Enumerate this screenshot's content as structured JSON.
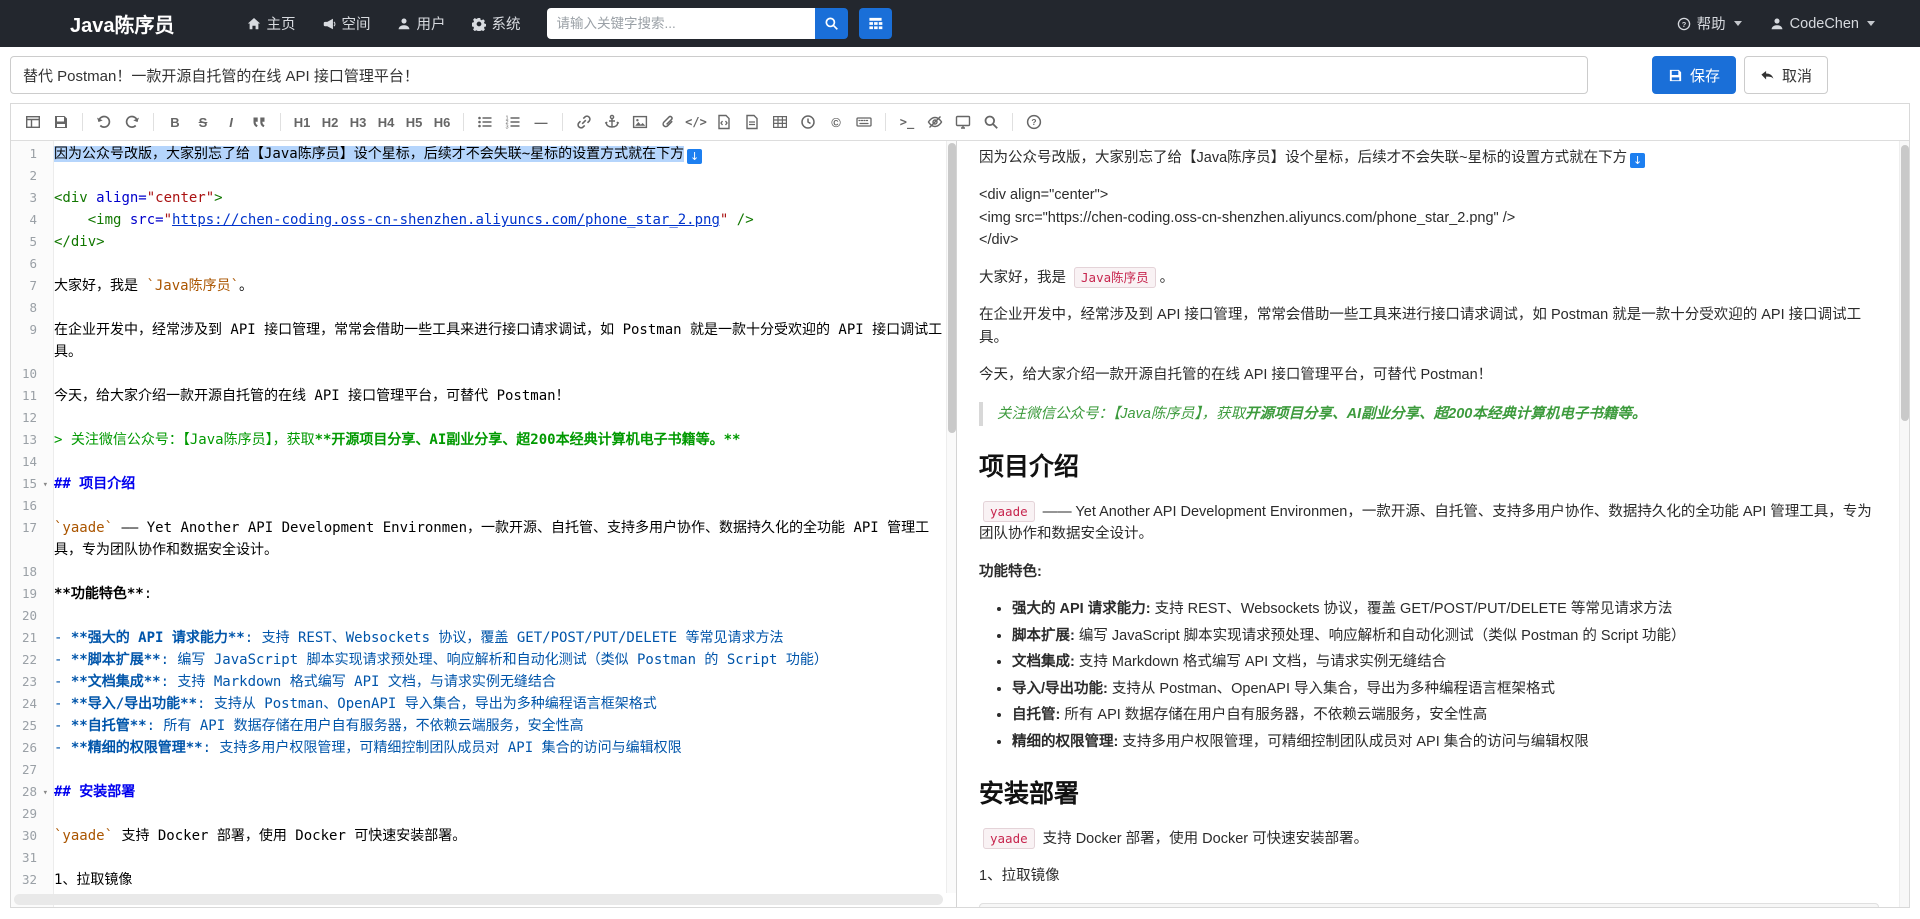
{
  "colors": {
    "navbar_bg": "#23272e",
    "accent_blue": "#1a6fd8",
    "selection_blue": "#b5d5fc",
    "inline_code_red": "#c7254e",
    "quote_green": "#3d9b3d"
  },
  "navbar": {
    "brand": "Java陈序员",
    "items": [
      {
        "icon": "home",
        "label": "主页"
      },
      {
        "icon": "bullhorn",
        "label": "空间"
      },
      {
        "icon": "user",
        "label": "用户"
      },
      {
        "icon": "gear",
        "label": "系统"
      }
    ],
    "search": {
      "placeholder": "请输入关键字搜索...",
      "button_icon": "search",
      "grid_button_icon": "grid"
    },
    "help_label": "帮助",
    "help_icon": "question-circle",
    "user_label": "CodeChen",
    "user_icon": "user"
  },
  "title_bar": {
    "title_value": "替代 Postman！一款开源自托管的在线 API 接口管理平台！",
    "save_label": "保存",
    "save_icon": "floppy",
    "cancel_label": "取消",
    "cancel_icon": "reply"
  },
  "toolbar": {
    "groups": [
      [
        "window",
        "save"
      ],
      [
        "undo",
        "redo"
      ],
      [
        "bold",
        "strikethrough",
        "italic",
        "quote"
      ],
      [
        "h1",
        "h2",
        "h3",
        "h4",
        "h5",
        "h6"
      ],
      [
        "list-ul",
        "list-ol",
        "horizontal-rule"
      ],
      [
        "link",
        "anchor",
        "image",
        "attachment",
        "inline-code",
        "code-block",
        "html-block",
        "table",
        "datetime",
        "copyright",
        "keyboard"
      ],
      [
        "terminal",
        "eye-slash",
        "monitor",
        "search"
      ],
      [
        "help"
      ]
    ]
  },
  "editor": {
    "lines": [
      {
        "n": 1,
        "active": true,
        "segments": [
          {
            "t": "因为公众号改版，大家别忘了给【Java陈序员】设个星标，后续才不会失联~星标的设置方式就在下方",
            "c": "txt",
            "sel": true
          },
          {
            "t": "👇",
            "c": "emoji",
            "sel": true
          }
        ]
      },
      {
        "n": 2
      },
      {
        "n": 3,
        "segments": [
          {
            "t": "<div ",
            "c": "tag"
          },
          {
            "t": "align=",
            "c": "attr"
          },
          {
            "t": "\"center\"",
            "c": "str"
          },
          {
            "t": ">",
            "c": "tag"
          }
        ]
      },
      {
        "n": 4,
        "segments": [
          {
            "t": "    ",
            "c": "txt"
          },
          {
            "t": "<img ",
            "c": "tag"
          },
          {
            "t": "src=",
            "c": "attr"
          },
          {
            "t": "\"",
            "c": "str"
          },
          {
            "t": "https://chen-coding.oss-cn-shenzhen.aliyuncs.com/phone_star_2.png",
            "c": "link"
          },
          {
            "t": "\"",
            "c": "str"
          },
          {
            "t": " />",
            "c": "tag"
          }
        ]
      },
      {
        "n": 5,
        "segments": [
          {
            "t": "</div>",
            "c": "tag"
          }
        ]
      },
      {
        "n": 6
      },
      {
        "n": 7,
        "segments": [
          {
            "t": "大家好，我是 ",
            "c": "txt"
          },
          {
            "t": "`Java陈序员`",
            "c": "code"
          },
          {
            "t": "。",
            "c": "txt"
          }
        ]
      },
      {
        "n": 8
      },
      {
        "n": 9,
        "segments": [
          {
            "t": "在企业开发中，经常涉及到 API 接口管理，常常会借助一些工具来进行接口请求调试，如 Postman 就是一款十分受欢迎的 API 接口调试工具。",
            "c": "txt"
          }
        ]
      },
      {
        "n": 10
      },
      {
        "n": 11,
        "segments": [
          {
            "t": "今天，给大家介绍一款开源自托管的在线 API 接口管理平台，可替代 Postman！",
            "c": "txt"
          }
        ]
      },
      {
        "n": 12
      },
      {
        "n": 13,
        "segments": [
          {
            "t": "> 关注微信公众号：【Java陈序员】，获取",
            "c": "quote"
          },
          {
            "t": "**开源项目分享、AI副业分享、超200本经典计算机电子书籍等。**",
            "c": "quote-strong"
          }
        ]
      },
      {
        "n": 14
      },
      {
        "n": 15,
        "fold": true,
        "segments": [
          {
            "t": "## 项目介绍",
            "c": "header"
          }
        ]
      },
      {
        "n": 16
      },
      {
        "n": 17,
        "segments": [
          {
            "t": "`yaade`",
            "c": "code"
          },
          {
            "t": " —— Yet Another API Development Environmen，一款开源、自托管、支持多用户协作、数据持久化的全功能 API 管理工具，专为团队协作和数据安全设计。",
            "c": "txt"
          }
        ]
      },
      {
        "n": 18
      },
      {
        "n": 19,
        "segments": [
          {
            "t": "**功能特色**",
            "c": "strong"
          },
          {
            "t": ":",
            "c": "txt"
          }
        ]
      },
      {
        "n": 20
      },
      {
        "n": 21,
        "segments": [
          {
            "t": "- ",
            "c": "list"
          },
          {
            "t": "**强大的 API 请求能力**",
            "c": "list-strong"
          },
          {
            "t": ": 支持 REST、Websockets 协议，覆盖 GET/POST/PUT/DELETE 等常见请求方法",
            "c": "list"
          }
        ]
      },
      {
        "n": 22,
        "segments": [
          {
            "t": "- ",
            "c": "list"
          },
          {
            "t": "**脚本扩展**",
            "c": "list-strong"
          },
          {
            "t": ": 编写 JavaScript 脚本实现请求预处理、响应解析和自动化测试（类似 Postman 的 Script 功能）",
            "c": "list"
          }
        ]
      },
      {
        "n": 23,
        "segments": [
          {
            "t": "- ",
            "c": "list"
          },
          {
            "t": "**文档集成**",
            "c": "list-strong"
          },
          {
            "t": ": 支持 Markdown 格式编写 API 文档，与请求实例无缝结合",
            "c": "list"
          }
        ]
      },
      {
        "n": 24,
        "segments": [
          {
            "t": "- ",
            "c": "list"
          },
          {
            "t": "**导入/导出功能**",
            "c": "list-strong"
          },
          {
            "t": ": 支持从 Postman、OpenAPI 导入集合，导出为多种编程语言框架格式",
            "c": "list"
          }
        ]
      },
      {
        "n": 25,
        "segments": [
          {
            "t": "- ",
            "c": "list"
          },
          {
            "t": "**自托管**",
            "c": "list-strong"
          },
          {
            "t": ": 所有 API 数据存储在用户自有服务器，不依赖云端服务，安全性高",
            "c": "list"
          }
        ]
      },
      {
        "n": 26,
        "segments": [
          {
            "t": "- ",
            "c": "list"
          },
          {
            "t": "**精细的权限管理**",
            "c": "list-strong"
          },
          {
            "t": ": 支持多用户权限管理，可精细控制团队成员对 API 集合的访问与编辑权限",
            "c": "list"
          }
        ]
      },
      {
        "n": 27
      },
      {
        "n": 28,
        "fold": true,
        "segments": [
          {
            "t": "## 安装部署",
            "c": "header"
          }
        ]
      },
      {
        "n": 29
      },
      {
        "n": 30,
        "segments": [
          {
            "t": "`yaade`",
            "c": "code"
          },
          {
            "t": " 支持 Docker 部署，使用 Docker 可快速安装部署。",
            "c": "txt"
          }
        ]
      },
      {
        "n": 31
      },
      {
        "n": 32,
        "segments": [
          {
            "t": "1、拉取镜像",
            "c": "txt"
          }
        ]
      }
    ]
  },
  "preview": {
    "blocks": [
      {
        "type": "p",
        "runs": [
          {
            "t": "因为公众号改版，大家别忘了给【Java陈序员】设个星标，后续才不会失联~星标的设置方式就在下方"
          },
          {
            "t": "👇",
            "emoji": true
          }
        ]
      },
      {
        "type": "p",
        "mt": true,
        "runs": [
          {
            "t": "<div align=\"center\">"
          },
          {
            "br": true
          },
          {
            "t": "<img src=\"https://chen-coding.oss-cn-shenzhen.aliyuncs.com/phone_star_2.png\" />"
          },
          {
            "br": true
          },
          {
            "t": "</div>"
          }
        ]
      },
      {
        "type": "p",
        "mt": true,
        "runs": [
          {
            "t": "大家好，我是 "
          },
          {
            "t": "Java陈序员",
            "code": true
          },
          {
            "t": "。"
          }
        ]
      },
      {
        "type": "p",
        "runs": [
          {
            "t": "在企业开发中，经常涉及到 API 接口管理，常常会借助一些工具来进行接口请求调试，如 Postman 就是一款十分受欢迎的 API 接口调试工具。"
          }
        ]
      },
      {
        "type": "p",
        "runs": [
          {
            "t": "今天，给大家介绍一款开源自托管的在线 API 接口管理平台，可替代 Postman！"
          }
        ]
      },
      {
        "type": "blockquote",
        "runs": [
          {
            "t": "关注微信公众号：【Java陈序员】，获取",
            "i": true
          },
          {
            "t": "开源项目分享、AI副业分享、超200本经典计算机电子书籍等。",
            "i": true,
            "b": true
          }
        ]
      },
      {
        "type": "h2",
        "text": "项目介绍"
      },
      {
        "type": "p",
        "runs": [
          {
            "t": "yaade",
            "code": true
          },
          {
            "t": " —— Yet Another API Development Environmen，一款开源、自托管、支持多用户协作、数据持久化的全功能 API 管理工具，专为团队协作和数据安全设计。"
          }
        ]
      },
      {
        "type": "p",
        "runs": [
          {
            "t": "功能特色:",
            "b": true
          }
        ]
      },
      {
        "type": "ul",
        "items": [
          [
            {
              "t": "强大的 API 请求能力:",
              "b": true
            },
            {
              "t": " 支持 REST、Websockets 协议，覆盖 GET/POST/PUT/DELETE 等常见请求方法"
            }
          ],
          [
            {
              "t": "脚本扩展:",
              "b": true
            },
            {
              "t": " 编写 JavaScript 脚本实现请求预处理、响应解析和自动化测试（类似 Postman 的 Script 功能）"
            }
          ],
          [
            {
              "t": "文档集成:",
              "b": true
            },
            {
              "t": " 支持 Markdown 格式编写 API 文档，与请求实例无缝结合"
            }
          ],
          [
            {
              "t": "导入/导出功能:",
              "b": true
            },
            {
              "t": " 支持从 Postman、OpenAPI 导入集合，导出为多种编程语言框架格式"
            }
          ],
          [
            {
              "t": "自托管:",
              "b": true
            },
            {
              "t": " 所有 API 数据存储在用户自有服务器，不依赖云端服务，安全性高"
            }
          ],
          [
            {
              "t": "精细的权限管理:",
              "b": true
            },
            {
              "t": " 支持多用户权限管理，可精细控制团队成员对 API 集合的访问与编辑权限"
            }
          ]
        ]
      },
      {
        "type": "h2",
        "text": "安装部署"
      },
      {
        "type": "p",
        "runs": [
          {
            "t": "yaade",
            "code": true
          },
          {
            "t": " 支持 Docker 部署，使用 Docker 可快速安装部署。"
          }
        ]
      },
      {
        "type": "p",
        "runs": [
          {
            "t": "1、拉取镜像"
          }
        ]
      },
      {
        "type": "codeblock"
      }
    ]
  }
}
